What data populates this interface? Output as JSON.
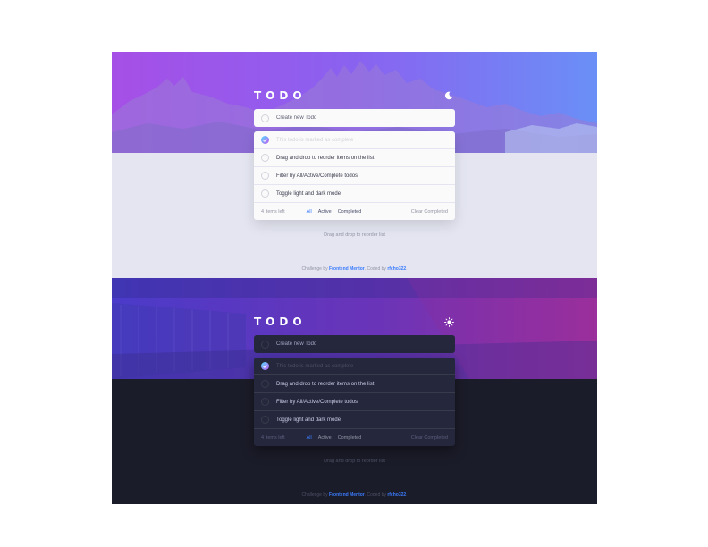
{
  "app": {
    "title": "TODO",
    "placeholder": "Create new Todo",
    "hint": "Drag and drop to reorder list",
    "attribution": {
      "prefix": "Challenge by ",
      "challenge_link": "Frontend Mentor",
      "middle": ". Coded by ",
      "author_link": "rfcho322",
      "suffix": "."
    }
  },
  "light": {
    "theme_icon": "moon-icon",
    "todos": [
      {
        "text": "This todo is marked as complete",
        "completed": true
      },
      {
        "text": "Drag and drop to reorder items on the list",
        "completed": false
      },
      {
        "text": "Filter by All/Active/Complete todos",
        "completed": false
      },
      {
        "text": "Toggle light and dark mode",
        "completed": false
      }
    ],
    "footer": {
      "items_left": "4 items left",
      "filter_all": "All",
      "filter_active": "Active",
      "filter_completed": "Completed",
      "clear": "Clear Completed"
    }
  },
  "dark": {
    "theme_icon": "sun-icon",
    "todos": [
      {
        "text": "This todo is marked as complete",
        "completed": true
      },
      {
        "text": "Drag and drop to reorder items on the list",
        "completed": false
      },
      {
        "text": "Filter by All/Active/Complete todos",
        "completed": false
      },
      {
        "text": "Toggle light and dark mode",
        "completed": false
      }
    ],
    "footer": {
      "items_left": "4 items left",
      "filter_all": "All",
      "filter_active": "Active",
      "filter_completed": "Completed",
      "clear": "Clear Completed"
    }
  },
  "colors": {
    "accent": "#3a7bfd",
    "check_gradient_start": "#57ddff",
    "check_gradient_end": "#c058f3",
    "light_bg": "#e4e5f1",
    "dark_bg": "#1b1c29"
  }
}
